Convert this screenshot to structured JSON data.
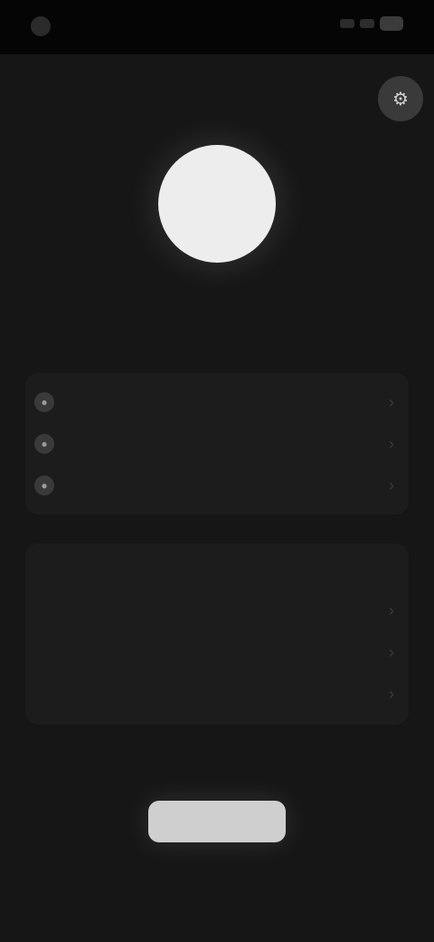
{
  "status": {
    "time": "",
    "carrier": ""
  },
  "header": {
    "title": "",
    "settings_icon": "gear-icon"
  },
  "profile": {
    "name": "",
    "handle": ""
  },
  "menu1": {
    "items": [
      {
        "label": "",
        "icon": "user-icon"
      },
      {
        "label": "",
        "icon": "bell-icon"
      },
      {
        "label": "",
        "icon": "lock-icon"
      }
    ]
  },
  "menu2": {
    "header": "",
    "items": [
      {
        "label": ""
      },
      {
        "label": ""
      },
      {
        "label": ""
      }
    ]
  },
  "footer": {
    "caption": "",
    "button_label": ""
  },
  "colors": {
    "background": "#161616",
    "card": "#1c1c1c",
    "button": "#cfcfcf"
  }
}
